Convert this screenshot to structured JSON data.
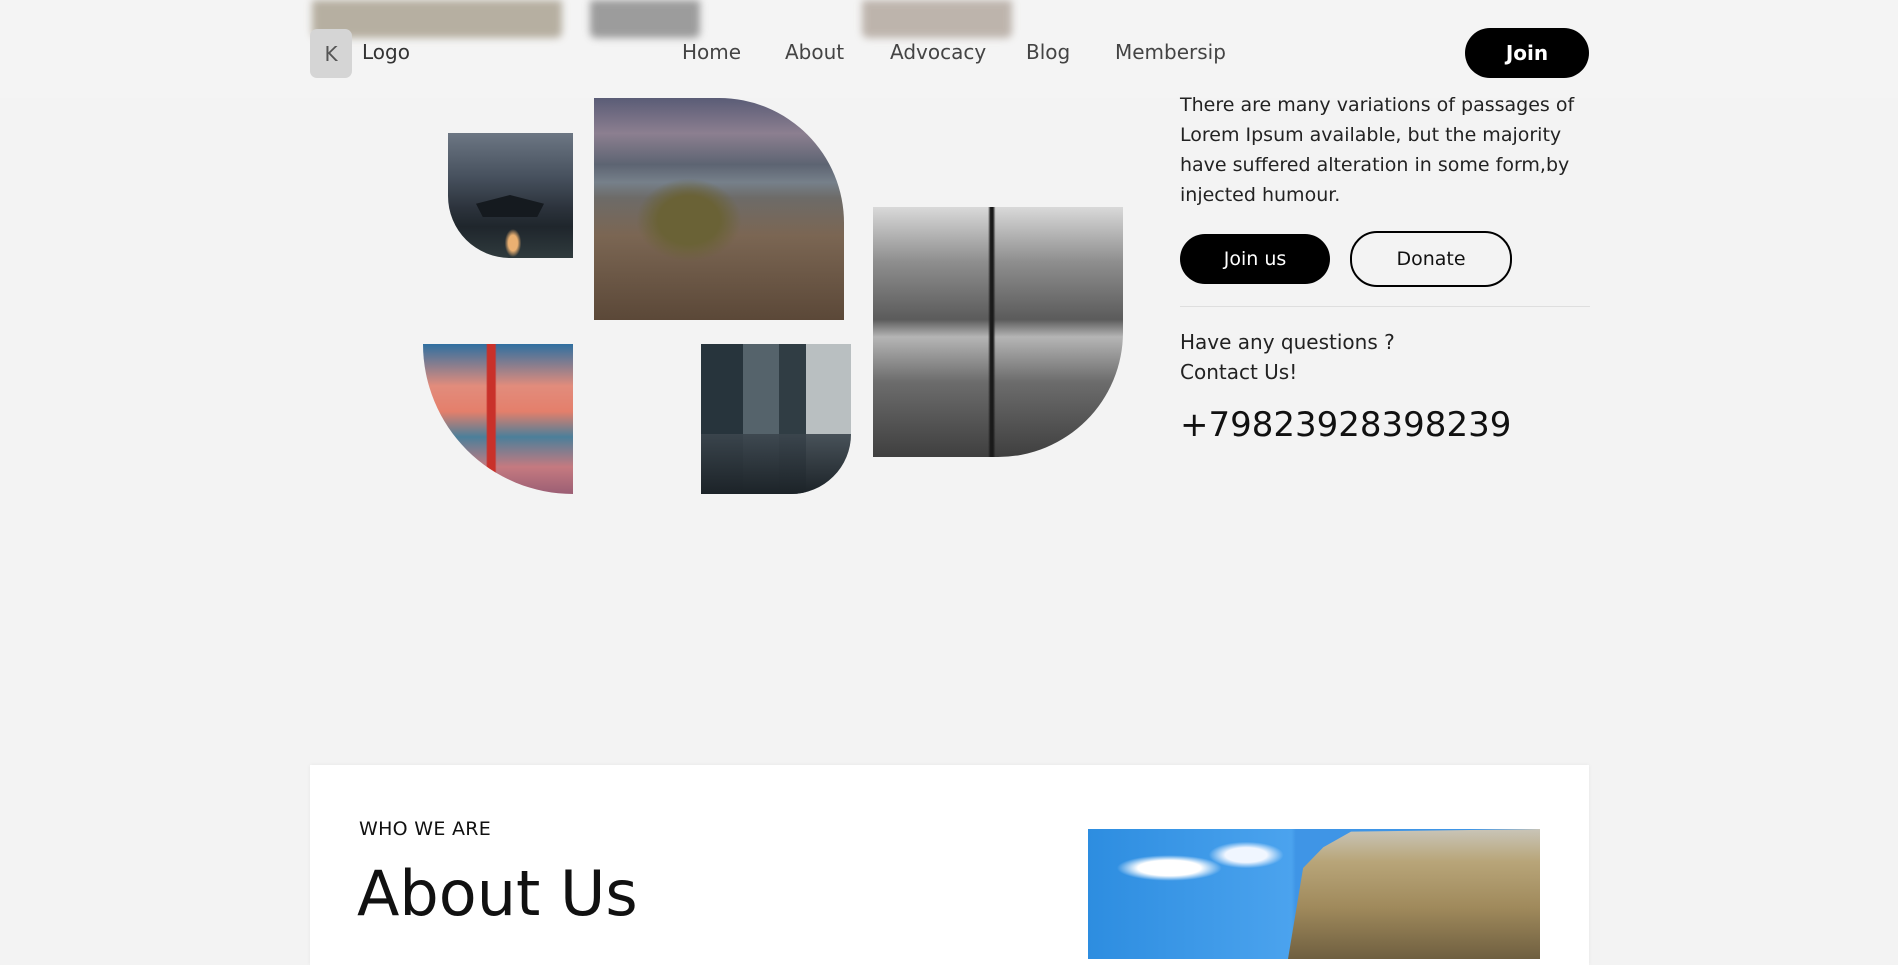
{
  "header": {
    "logo_letter": "K",
    "logo_text": "Logo",
    "nav": [
      "Home",
      "About",
      "Advocacy",
      "Blog",
      "Membersip"
    ],
    "join_label": "Join"
  },
  "hero": {
    "description": "There are many variations of passages of Lorem Ipsum available, but the majority have suffered alteration in some form,by injected humour.",
    "join_us_label": "Join us",
    "donate_label": "Donate",
    "questions_line1": "Have any questions ?",
    "questions_line2": "Contact Us!",
    "phone": "+79823928398239"
  },
  "about": {
    "eyebrow": "WHO WE ARE",
    "title": "About Us"
  },
  "colors": {
    "background": "#f3f3f3",
    "primary": "#000000",
    "card": "#ffffff"
  }
}
